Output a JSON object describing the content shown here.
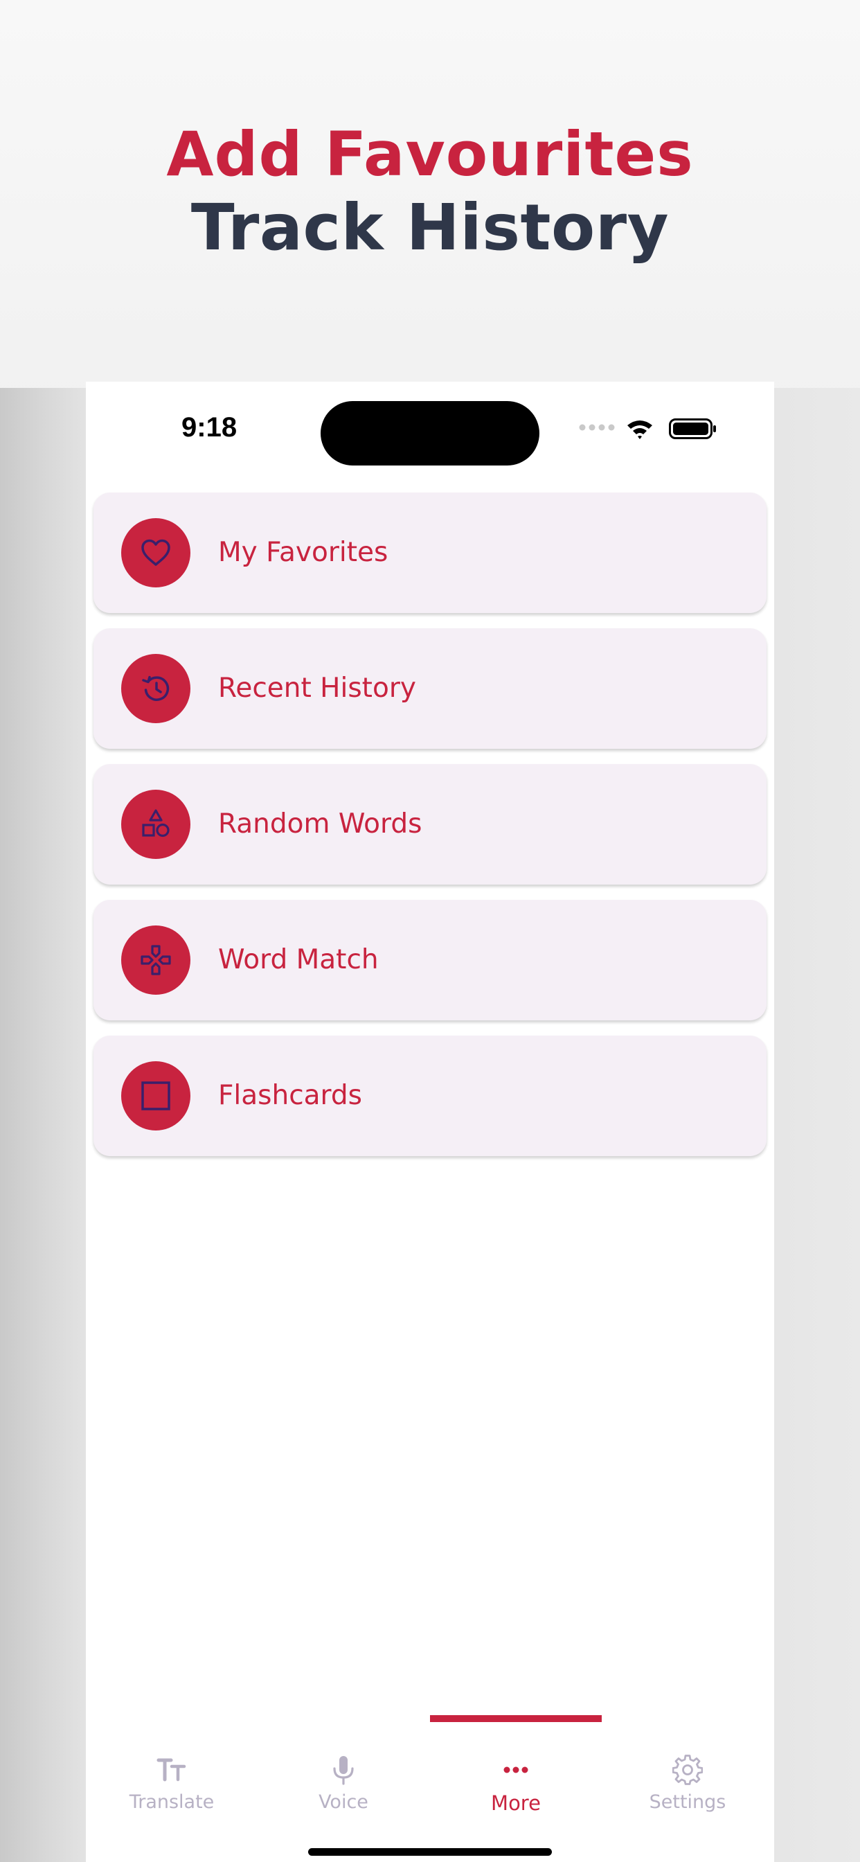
{
  "headline": {
    "line1": "Add Favourites",
    "line2": "Track History"
  },
  "status_bar": {
    "time": "9:18"
  },
  "menu": {
    "items": [
      {
        "label": "My Favorites",
        "icon": "heart-icon"
      },
      {
        "label": "Recent History",
        "icon": "history-icon"
      },
      {
        "label": "Random Words",
        "icon": "shapes-icon"
      },
      {
        "label": "Word Match",
        "icon": "gamepad-icon"
      },
      {
        "label": "Flashcards",
        "icon": "square-icon"
      }
    ]
  },
  "tabbar": {
    "tabs": [
      {
        "label": "Translate",
        "icon": "text-size-icon",
        "active": false
      },
      {
        "label": "Voice",
        "icon": "microphone-icon",
        "active": false
      },
      {
        "label": "More",
        "icon": "more-dots-icon",
        "active": true
      },
      {
        "label": "Settings",
        "icon": "gear-icon",
        "active": false
      }
    ]
  },
  "colors": {
    "accent": "#c8233f",
    "headline_dark": "#2f3749",
    "card_bg": "#f5eff6",
    "icon_glyph": "#3a1f6b",
    "tab_inactive": "#b7b1c4"
  }
}
